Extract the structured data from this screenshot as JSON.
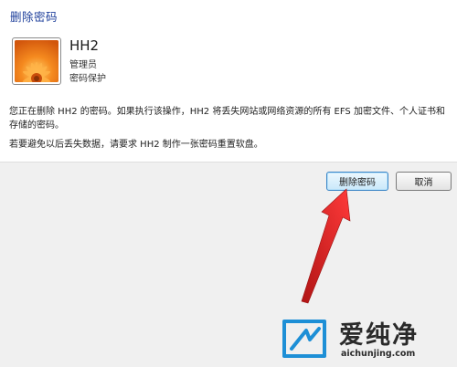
{
  "dialog": {
    "title": "删除密码"
  },
  "user": {
    "name": "HH2",
    "role": "管理员",
    "status": "密码保护"
  },
  "message": {
    "warning": "您正在删除 HH2 的密码。如果执行该操作，HH2 将丢失网站或网络资源的所有 EFS 加密文件、个人证书和存储的密码。",
    "advice": "若要避免以后丢失数据，请要求 HH2 制作一张密码重置软盘。"
  },
  "buttons": {
    "delete_label": "删除密码",
    "cancel_label": "取消"
  },
  "watermark": {
    "brand": "爱纯净",
    "url": "aichunjing.com"
  },
  "colors": {
    "title": "#1e3f9b",
    "arrow": "#e02020",
    "footer_bg": "#f0f0f0",
    "primary_border": "#3b85c6"
  },
  "icons": {
    "avatar": "flower-avatar-icon",
    "arrow": "red-arrow-annotation",
    "watermark": "watermark-logo-icon"
  }
}
